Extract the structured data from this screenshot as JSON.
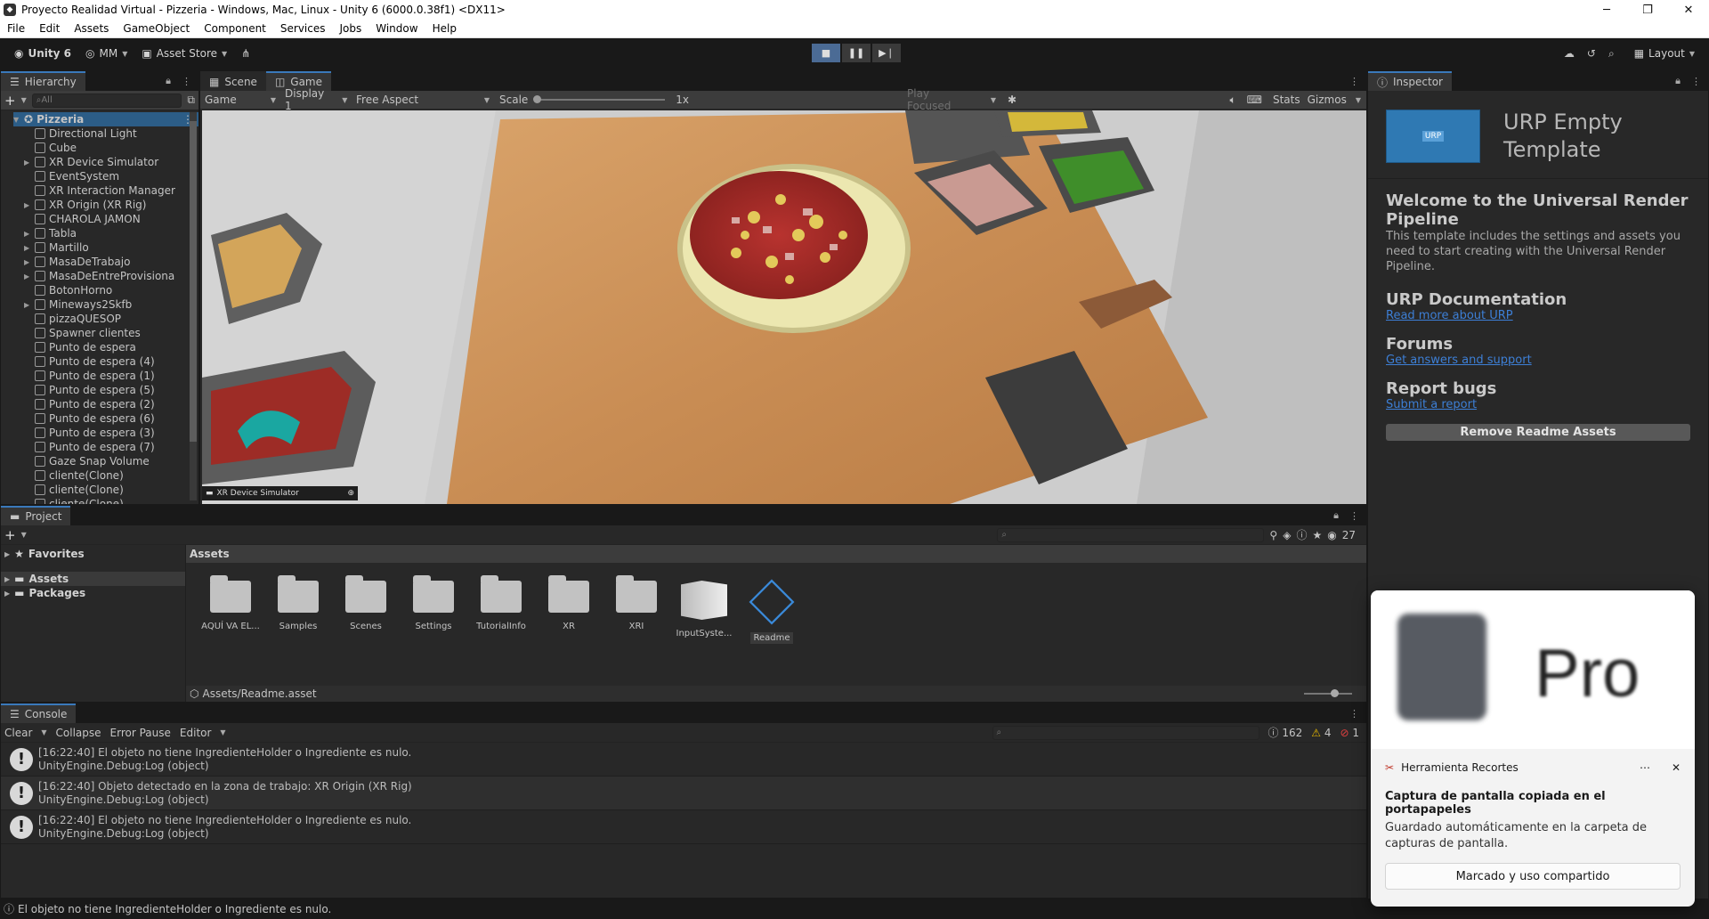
{
  "window": {
    "title": "Proyecto Realidad Virtual - Pizzeria - Windows, Mac, Linux - Unity 6 (6000.0.38f1) <DX11>"
  },
  "menu": [
    "File",
    "Edit",
    "Assets",
    "GameObject",
    "Component",
    "Services",
    "Jobs",
    "Window",
    "Help"
  ],
  "toolbar": {
    "unity_label": "Unity 6",
    "account": "MM",
    "asset_store": "Asset Store",
    "layout": "Layout"
  },
  "hierarchy": {
    "tab": "Hierarchy",
    "search_placeholder": "All",
    "scene": "Pizzeria",
    "items": [
      {
        "label": "Directional Light",
        "expandable": false
      },
      {
        "label": "Cube",
        "expandable": false
      },
      {
        "label": "XR Device Simulator",
        "expandable": true
      },
      {
        "label": "EventSystem",
        "expandable": false
      },
      {
        "label": "XR Interaction Manager",
        "expandable": false
      },
      {
        "label": "XR Origin (XR Rig)",
        "expandable": true
      },
      {
        "label": "CHAROLA JAMON",
        "expandable": false
      },
      {
        "label": "Tabla",
        "expandable": true
      },
      {
        "label": "Martillo",
        "expandable": true
      },
      {
        "label": "MasaDeTrabajo",
        "expandable": true
      },
      {
        "label": "MasaDeEntreProvisiona",
        "expandable": true
      },
      {
        "label": "BotonHorno",
        "expandable": false
      },
      {
        "label": "Mineways2Skfb",
        "expandable": true
      },
      {
        "label": "pizzaQUESOP",
        "expandable": false
      },
      {
        "label": "Spawner clientes",
        "expandable": false
      },
      {
        "label": "Punto de espera",
        "expandable": false
      },
      {
        "label": "Punto de espera (4)",
        "expandable": false
      },
      {
        "label": "Punto de espera (1)",
        "expandable": false
      },
      {
        "label": "Punto de espera (5)",
        "expandable": false
      },
      {
        "label": "Punto de espera (2)",
        "expandable": false
      },
      {
        "label": "Punto de espera (6)",
        "expandable": false
      },
      {
        "label": "Punto de espera (3)",
        "expandable": false
      },
      {
        "label": "Punto de espera (7)",
        "expandable": false
      },
      {
        "label": "Gaze Snap Volume",
        "expandable": false
      },
      {
        "label": "cliente(Clone)",
        "expandable": false
      },
      {
        "label": "cliente(Clone)",
        "expandable": false
      },
      {
        "label": "cliente(Clone)",
        "expandable": false
      }
    ]
  },
  "gameview": {
    "tabs": [
      "Scene",
      "Game"
    ],
    "game_dropdown": "Game",
    "display": "Display 1",
    "aspect": "Free Aspect",
    "scale_label": "Scale",
    "scale_value": "1x",
    "play_focused": "Play Focused",
    "stats": "Stats",
    "gizmos": "Gizmos",
    "overlay_label": "XR Device Simulator"
  },
  "inspector": {
    "tab": "Inspector",
    "title": "URP Empty Template",
    "thumb_text": "URP",
    "welcome_heading": "Welcome to the Universal Render Pipeline",
    "welcome_text": "This template includes the settings and assets you need to start creating with the Universal Render Pipeline.",
    "sections": [
      {
        "heading": "URP Documentation",
        "link": "Read more about URP"
      },
      {
        "heading": "Forums",
        "link": "Get answers and support"
      },
      {
        "heading": "Report bugs",
        "link": "Submit a report"
      }
    ],
    "remove_button": "Remove Readme Assets"
  },
  "project": {
    "tab": "Project",
    "favorites": "Favorites",
    "tree": [
      "Assets",
      "Packages"
    ],
    "breadcrumb": "Assets",
    "count": "27",
    "assets": [
      {
        "label": "AQUÍ VA EL...",
        "kind": "folder"
      },
      {
        "label": "Samples",
        "kind": "folder"
      },
      {
        "label": "Scenes",
        "kind": "folder"
      },
      {
        "label": "Settings",
        "kind": "folder"
      },
      {
        "label": "TutorialInfo",
        "kind": "folder"
      },
      {
        "label": "XR",
        "kind": "folder"
      },
      {
        "label": "XRI",
        "kind": "folder"
      },
      {
        "label": "InputSyste...",
        "kind": "input"
      },
      {
        "label": "Readme",
        "kind": "readme"
      }
    ],
    "selected_path": "Assets/Readme.asset"
  },
  "console": {
    "tab": "Console",
    "buttons": [
      "Clear",
      "Collapse",
      "Error Pause",
      "Editor"
    ],
    "info_count": "162",
    "warn_count": "4",
    "error_count": "1",
    "entries": [
      {
        "line1": "[16:22:40] El objeto no tiene IngredienteHolder o Ingrediente es nulo.",
        "line2": "UnityEngine.Debug:Log (object)"
      },
      {
        "line1": "[16:22:40] Objeto detectado en la zona de trabajo: XR Origin (XR Rig)",
        "line2": "UnityEngine.Debug:Log (object)"
      },
      {
        "line1": "[16:22:40] El objeto no tiene IngredienteHolder o Ingrediente es nulo.",
        "line2": "UnityEngine.Debug:Log (object)"
      }
    ]
  },
  "status": {
    "message": "El objeto no tiene IngredienteHolder o Ingrediente es nulo."
  },
  "toast": {
    "preview_text": "Pro",
    "app": "Herramienta Recortes",
    "title": "Captura de pantalla copiada en el portapapeles",
    "body": "Guardado automáticamente en la carpeta de capturas de pantalla.",
    "button": "Marcado y uso compartido"
  },
  "colors": {
    "accent": "#3a79bb",
    "panel": "#282828",
    "link": "#3d7fd6"
  }
}
